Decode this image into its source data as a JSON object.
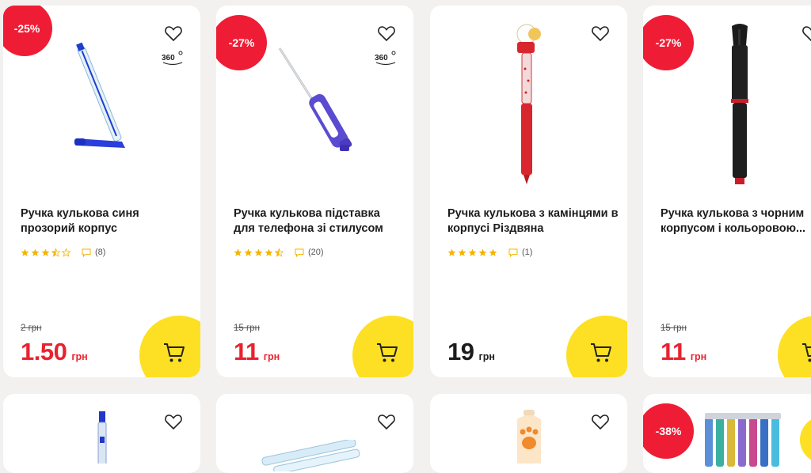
{
  "colors": {
    "discount": "#ee1d35",
    "price_red": "#e9222e",
    "cart_yellow": "#fde023",
    "star": "#f3b400"
  },
  "products": [
    {
      "badge": "-25%",
      "title_1": "Ручка кулькова синя",
      "title_2": "прозорий корпус",
      "rating": 3.5,
      "reviews": "(8)",
      "old_price": "2 грн",
      "price": "1.50",
      "currency": "грн",
      "has_360": true,
      "icon_360": "360"
    },
    {
      "badge": "-27%",
      "title_1": "Ручка кулькова підставка",
      "title_2": "для телефона зі стилусом",
      "rating": 4.5,
      "reviews": "(20)",
      "old_price": "15 грн",
      "price": "11",
      "currency": "грн",
      "has_360": true,
      "icon_360": "360"
    },
    {
      "badge": "",
      "title_1": "Ручка кулькова з камінцями в",
      "title_2": "корпусі Різдвяна",
      "rating": 5,
      "reviews": "(1)",
      "old_price": "",
      "price": "19",
      "currency": "грн",
      "has_360": false
    },
    {
      "badge": "-27%",
      "title_1": "Ручка кулькова з чорним",
      "title_2": "корпусом і кольоровою...",
      "rating": 0,
      "reviews": "",
      "old_price": "15 грн",
      "price": "11",
      "currency": "грн",
      "has_360": false
    },
    {
      "badge": "-38%"
    }
  ]
}
